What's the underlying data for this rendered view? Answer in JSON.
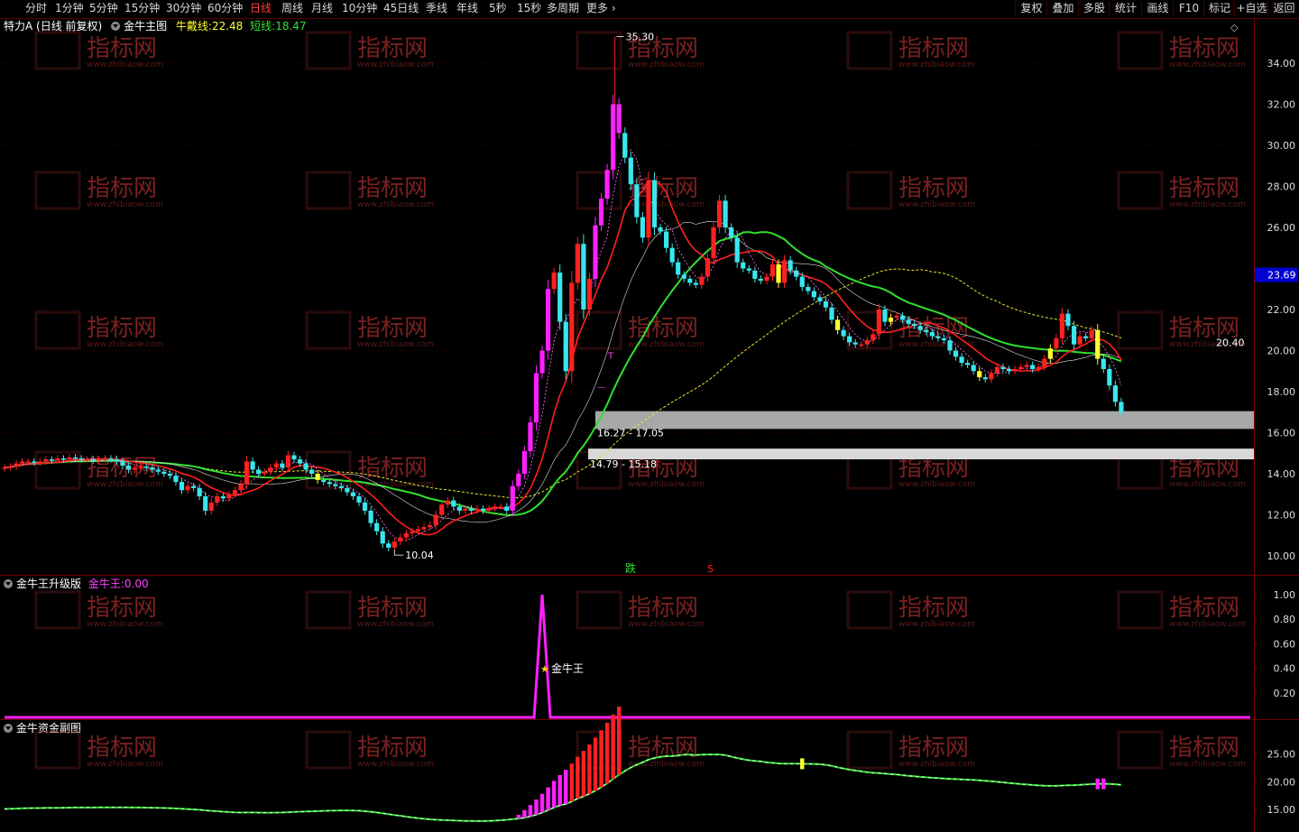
{
  "toolbar": {
    "left_items": [
      "分时",
      "1分钟",
      "5分钟",
      "15分钟",
      "30分钟",
      "60分钟",
      "日线",
      "周线",
      "月线",
      "10分钟",
      "45日线",
      "季线",
      "年线",
      "5秒",
      "15秒",
      "多周期",
      "更多"
    ],
    "active": "日线",
    "right_items": [
      "复权",
      "叠加",
      "多股",
      "统计",
      "画线",
      "F10",
      "标记",
      "+自选",
      "返回"
    ]
  },
  "main_panel": {
    "stock_name": "特力A",
    "period": "(日线 前复权)",
    "indicator": "金牛主图",
    "long_label": "牛戴线:",
    "long_value": "22.48",
    "short_label": "短线:",
    "short_value": "18.47",
    "current_price_tag": "23.69",
    "markers": {
      "high": "35.30",
      "low": "10.04",
      "mid": "20.40",
      "die": "跌",
      "s": "S"
    },
    "zone_labels": [
      "16.27 - 17.05",
      "14.79 - 15.18"
    ]
  },
  "sub_panel_1": {
    "title": "金牛王升级版",
    "label": "金牛王:",
    "value": "0.00",
    "marker_text": "金牛王"
  },
  "sub_panel_2": {
    "title": "金牛资金副图"
  },
  "watermark": {
    "text": "指标网",
    "sub": "www.zhibiaow.com"
  },
  "colors": {
    "up": "#ff2020",
    "down": "#39e6ee",
    "special": "#ff20ff",
    "yellow": "#ffff30",
    "long_line": "#ff2020",
    "green_line": "#30e030",
    "dashed": "#e8e830"
  },
  "chart_data": {
    "type": "candlestick",
    "price_axis": {
      "ticks": [
        10,
        12,
        14,
        16,
        18,
        20,
        22,
        24,
        26,
        28,
        30,
        32,
        34
      ],
      "labels": [
        "10.00",
        "12.00",
        "14.00",
        "16.00",
        "18.00",
        "20.00",
        "22.00",
        "26.00",
        "28.00",
        "30.00",
        "32.00",
        "34.00"
      ],
      "range": [
        9.2,
        36.2
      ]
    },
    "closes": [
      14.3,
      14.35,
      14.5,
      14.6,
      14.6,
      14.55,
      14.6,
      14.7,
      14.65,
      14.75,
      14.7,
      14.8,
      14.75,
      14.7,
      14.7,
      14.65,
      14.7,
      14.75,
      14.7,
      14.6,
      14.4,
      14.2,
      14.3,
      14.35,
      14.3,
      14.2,
      14.1,
      14.0,
      13.9,
      13.6,
      13.2,
      13.4,
      13.3,
      12.9,
      12.2,
      12.6,
      12.9,
      12.8,
      13.0,
      13.2,
      13.5,
      14.6,
      14.2,
      14.0,
      14.1,
      14.3,
      14.5,
      14.3,
      14.9,
      14.7,
      14.5,
      14.2,
      14.0,
      13.7,
      13.6,
      13.5,
      13.4,
      13.3,
      13.1,
      12.9,
      12.6,
      12.2,
      11.6,
      11.2,
      10.6,
      10.4,
      10.7,
      10.9,
      11.1,
      11.2,
      11.3,
      11.4,
      11.5,
      12.0,
      12.5,
      12.7,
      12.4,
      12.2,
      12.3,
      12.2,
      12.3,
      12.2,
      12.3,
      12.4,
      12.4,
      12.2,
      13.4,
      14.0,
      15.1,
      16.5,
      18.9,
      20.0,
      23.0,
      23.8,
      21.4,
      19.0,
      23.3,
      25.2,
      22.0,
      23.5,
      26.1,
      27.4,
      28.8,
      32.0,
      30.6,
      29.4,
      28.1,
      26.5,
      25.5,
      28.3,
      26.0,
      25.8,
      25.0,
      24.3,
      23.7,
      23.5,
      23.3,
      23.2,
      23.6,
      24.5,
      26.0,
      27.3,
      26.0,
      25.5,
      24.3,
      24.0,
      23.9,
      23.5,
      23.4,
      23.6,
      24.2,
      23.3,
      24.4,
      23.9,
      23.6,
      23.1,
      22.9,
      22.6,
      22.4,
      22.1,
      21.5,
      21.0,
      20.7,
      20.4,
      20.3,
      20.3,
      20.5,
      20.8,
      22.0,
      21.4,
      21.6,
      21.7,
      21.5,
      21.3,
      21.2,
      21.0,
      20.9,
      20.7,
      20.6,
      20.5,
      20.0,
      19.7,
      19.4,
      19.3,
      19.0,
      18.7,
      18.6,
      18.9,
      19.2,
      19.1,
      19.0,
      19.1,
      19.2,
      19.3,
      19.1,
      19.2,
      19.6,
      20.1,
      20.6,
      21.8,
      21.2,
      20.3,
      20.7,
      20.6,
      21.0,
      19.6,
      19.1,
      18.3,
      17.5,
      17.0
    ],
    "sub1": {
      "axis": [
        "0.20",
        "0.40",
        "0.60",
        "0.80",
        "1.00"
      ],
      "peak_index": 91,
      "peak": 1.0
    },
    "sub2": {
      "axis": [
        "15.00",
        "20.00",
        "25.00"
      ]
    }
  }
}
